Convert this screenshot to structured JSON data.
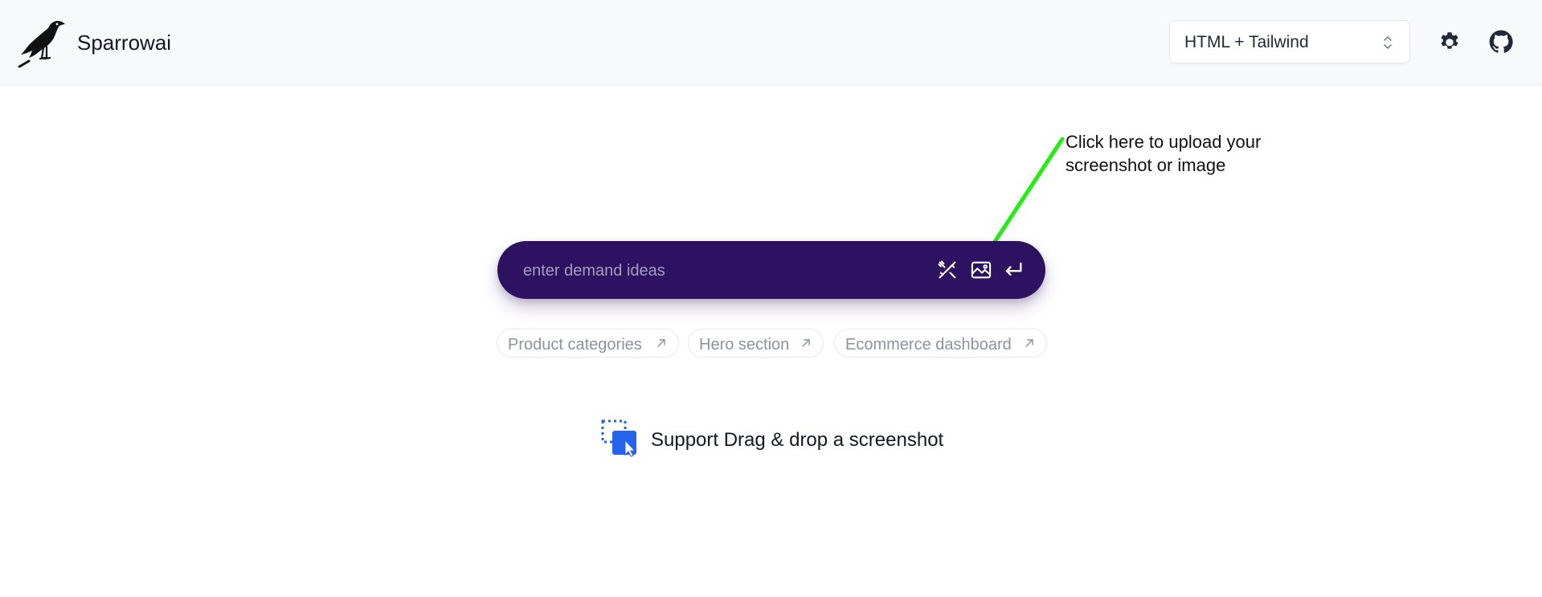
{
  "header": {
    "brand": "Sparrowai",
    "framework_select": {
      "value": "HTML + Tailwind"
    },
    "icons": [
      "bird-logo-icon",
      "gear-icon",
      "github-icon",
      "chevron-up-down-icon"
    ]
  },
  "annotation": {
    "text": "Click here to upload your screenshot or image",
    "arrow_color": "#22ee11"
  },
  "search": {
    "placeholder": "enter demand ideas",
    "value": "",
    "background": "#2e1262",
    "icons": [
      "magic-tools-icon",
      "image-upload-icon",
      "enter-icon"
    ]
  },
  "suggestions": [
    {
      "label": "Product categories"
    },
    {
      "label": "Hero section"
    },
    {
      "label": "Ecommerce dashboard"
    }
  ],
  "dropzone": {
    "text": "Support Drag & drop a screenshot",
    "icon": "drag-drop-icon",
    "accent": "#2563eb"
  }
}
